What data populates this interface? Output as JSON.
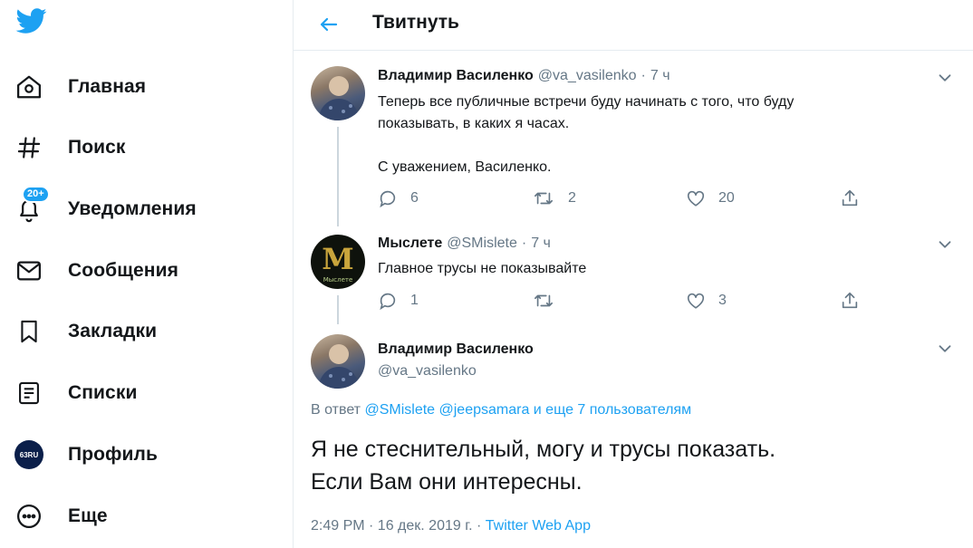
{
  "sidebar": {
    "nav": [
      {
        "label": "Главная",
        "icon": "home-icon"
      },
      {
        "label": "Поиск",
        "icon": "hashtag-icon"
      },
      {
        "label": "Уведомления",
        "icon": "bell-icon",
        "badge": "20+"
      },
      {
        "label": "Сообщения",
        "icon": "envelope-icon"
      },
      {
        "label": "Закладки",
        "icon": "bookmark-icon"
      },
      {
        "label": "Списки",
        "icon": "list-icon"
      },
      {
        "label": "Профиль",
        "icon": "profile-avatar-icon",
        "avatar_text": "63RU"
      },
      {
        "label": "Еще",
        "icon": "more-circle-icon"
      }
    ]
  },
  "header": {
    "title": "Твитнуть"
  },
  "tweets": [
    {
      "name": "Владимир Василенко",
      "handle": "@va_vasilenko",
      "sep": "·",
      "time": "7 ч",
      "text": "Теперь все публичные встречи буду начинать с того, что буду\nпоказывать, в каких я часах.\n\nС уважением, Василенко.",
      "replies": "6",
      "retweets": "2",
      "likes": "20"
    },
    {
      "name": "Мыслете",
      "handle": "@SMislete",
      "sep": "·",
      "time": "7 ч",
      "text": "Главное трусы не показывайте",
      "replies": "1",
      "retweets": "",
      "likes": "3",
      "avatar_letter": "M",
      "avatar_caption": "Мыслете"
    }
  ],
  "focused": {
    "name": "Владимир Василенко",
    "handle": "@va_vasilenko",
    "reply_prefix": "В ответ",
    "reply_links": "@SMislete @jeepsamara и еще 7 пользователям",
    "text": "Я не стеснительный, могу и трусы показать.\nЕсли Вам они интересны.",
    "timestamp": "2:49 PM · 16 дек. 2019 г. · ",
    "app": "Twitter Web App"
  },
  "colors": {
    "accent": "#1da1f2",
    "secondary": "#657786",
    "border": "#e6ecf0"
  }
}
